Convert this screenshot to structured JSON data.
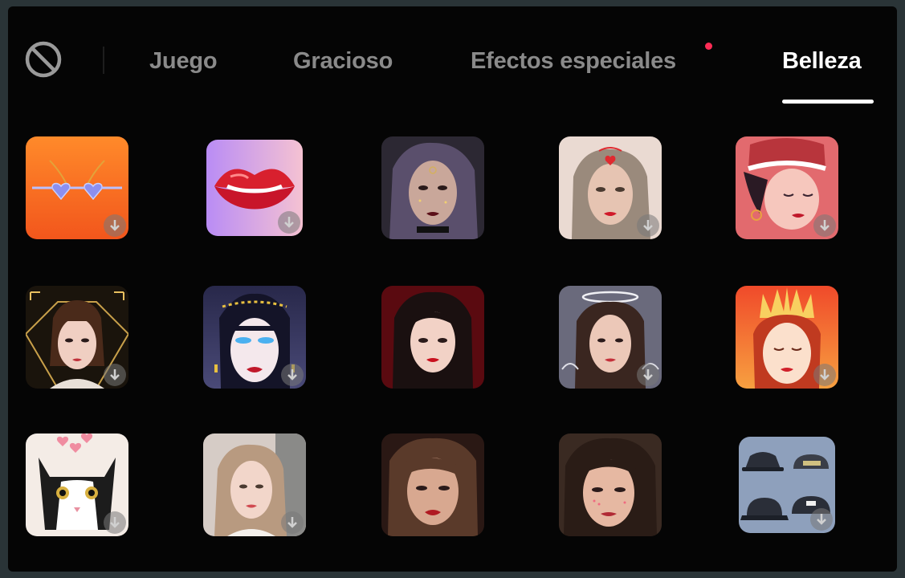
{
  "tabs": {
    "juego": "Juego",
    "gracioso": "Gracioso",
    "efectos": "Efectos especiales",
    "belleza": "Belleza",
    "active": "belleza"
  },
  "colors": {
    "background": "#050505",
    "active_tab": "#ffffff",
    "inactive_tab": "#8a8a8a",
    "new_indicator": "#fe2c55"
  },
  "effects": [
    {
      "name": "heart-sunglasses-effect",
      "icon": "heart-glasses-icon",
      "downloadable": true
    },
    {
      "name": "red-lips-effect",
      "icon": "lips-icon",
      "downloadable": true
    },
    {
      "name": "dark-makeup-effect",
      "icon": "face-portrait",
      "downloadable": false
    },
    {
      "name": "blonde-heart-effect",
      "icon": "face-portrait",
      "downloadable": true
    },
    {
      "name": "cartoon-hat-girl-effect",
      "icon": "cartoon-girl-icon",
      "downloadable": true
    },
    {
      "name": "gold-frame-effect",
      "icon": "face-portrait",
      "downloadable": true
    },
    {
      "name": "egyptian-queen-effect",
      "icon": "cartoon-queen-icon",
      "downloadable": true
    },
    {
      "name": "red-lip-beauty-effect",
      "icon": "face-portrait",
      "downloadable": false
    },
    {
      "name": "angel-halo-effect",
      "icon": "face-portrait",
      "downloadable": true
    },
    {
      "name": "sun-crown-effect",
      "icon": "cartoon-crown-icon",
      "downloadable": true
    },
    {
      "name": "cat-hearts-effect",
      "icon": "cat-icon",
      "downloadable": true
    },
    {
      "name": "soft-glow-effect",
      "icon": "face-portrait",
      "downloadable": true
    },
    {
      "name": "glam-makeup-effect",
      "icon": "face-portrait",
      "downloadable": false
    },
    {
      "name": "sparkle-freckles-effect",
      "icon": "face-portrait",
      "downloadable": false
    },
    {
      "name": "hats-effect",
      "icon": "hats-icon",
      "downloadable": true
    }
  ]
}
